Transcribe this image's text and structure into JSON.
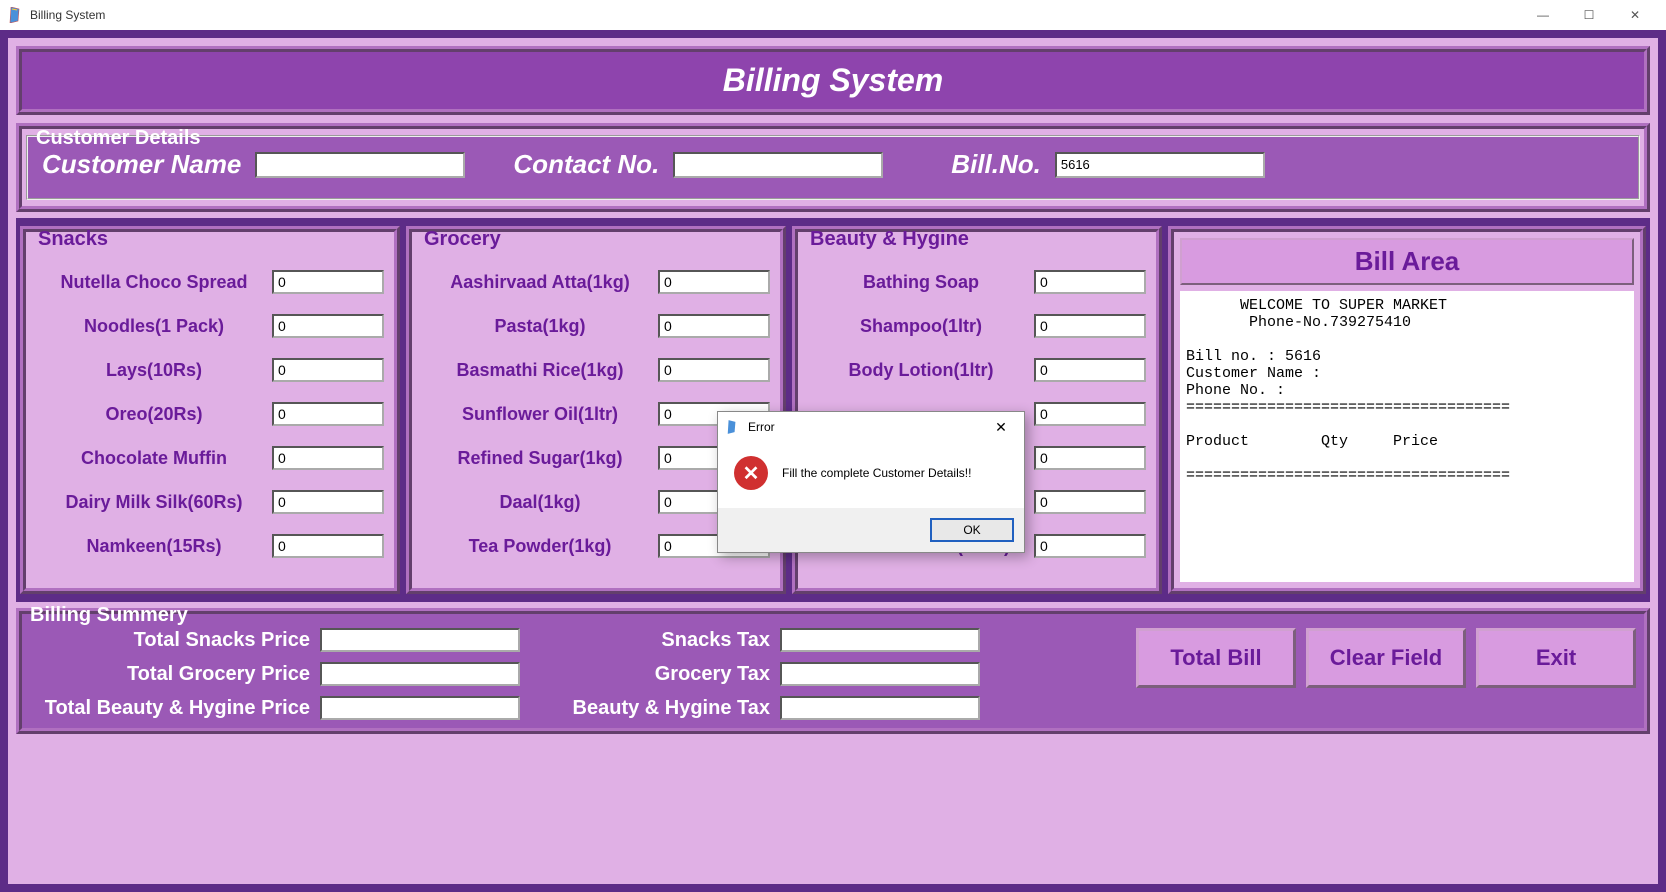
{
  "window": {
    "title": "Billing System"
  },
  "banner": "Billing System",
  "customer": {
    "legend": "Customer Details",
    "name_label": "Customer Name",
    "name_value": "",
    "contact_label": "Contact No.",
    "contact_value": "",
    "billno_label": "Bill.No.",
    "billno_value": "5616"
  },
  "snacks": {
    "legend": "Snacks",
    "items": [
      {
        "label": "Nutella Choco Spread",
        "value": "0"
      },
      {
        "label": "Noodles(1 Pack)",
        "value": "0"
      },
      {
        "label": "Lays(10Rs)",
        "value": "0"
      },
      {
        "label": "Oreo(20Rs)",
        "value": "0"
      },
      {
        "label": "Chocolate Muffin",
        "value": "0"
      },
      {
        "label": "Dairy Milk Silk(60Rs)",
        "value": "0"
      },
      {
        "label": "Namkeen(15Rs)",
        "value": "0"
      }
    ]
  },
  "grocery": {
    "legend": "Grocery",
    "items": [
      {
        "label": "Aashirvaad Atta(1kg)",
        "value": "0"
      },
      {
        "label": "Pasta(1kg)",
        "value": "0"
      },
      {
        "label": "Basmathi Rice(1kg)",
        "value": "0"
      },
      {
        "label": "Sunflower Oil(1ltr)",
        "value": "0"
      },
      {
        "label": "Refined Sugar(1kg)",
        "value": "0"
      },
      {
        "label": "Daal(1kg)",
        "value": "0"
      },
      {
        "label": "Tea Powder(1kg)",
        "value": "0"
      }
    ]
  },
  "beauty": {
    "legend": "Beauty & Hygine",
    "items": [
      {
        "label": "Bathing Soap",
        "value": "0"
      },
      {
        "label": "Shampoo(1ltr)",
        "value": "0"
      },
      {
        "label": "Body Lotion(1ltr)",
        "value": "0"
      },
      {
        "label": "",
        "value": "0"
      },
      {
        "label": "",
        "value": "0"
      },
      {
        "label": "",
        "value": "0"
      },
      {
        "label": "Hand Sanitizer(50ml)",
        "value": "0"
      }
    ]
  },
  "billarea": {
    "title": "Bill Area",
    "text": "      WELCOME TO SUPER MARKET\n       Phone-No.739275410\n\nBill no. : 5616\nCustomer Name :\nPhone No. :\n====================================\n\nProduct        Qty     Price\n\n===================================="
  },
  "summary": {
    "legend": "Billing Summery",
    "rows": [
      {
        "label": "Total Snacks Price",
        "tax_label": "Snacks Tax",
        "price": "",
        "tax": ""
      },
      {
        "label": "Total Grocery Price",
        "tax_label": "Grocery Tax",
        "price": "",
        "tax": ""
      },
      {
        "label": "Total Beauty & Hygine Price",
        "tax_label": "Beauty & Hygine Tax",
        "price": "",
        "tax": ""
      }
    ],
    "buttons": {
      "total": "Total Bill",
      "clear": "Clear Field",
      "exit": "Exit"
    }
  },
  "dialog": {
    "title": "Error",
    "message": "Fill the complete Customer Details!!",
    "ok": "OK"
  }
}
